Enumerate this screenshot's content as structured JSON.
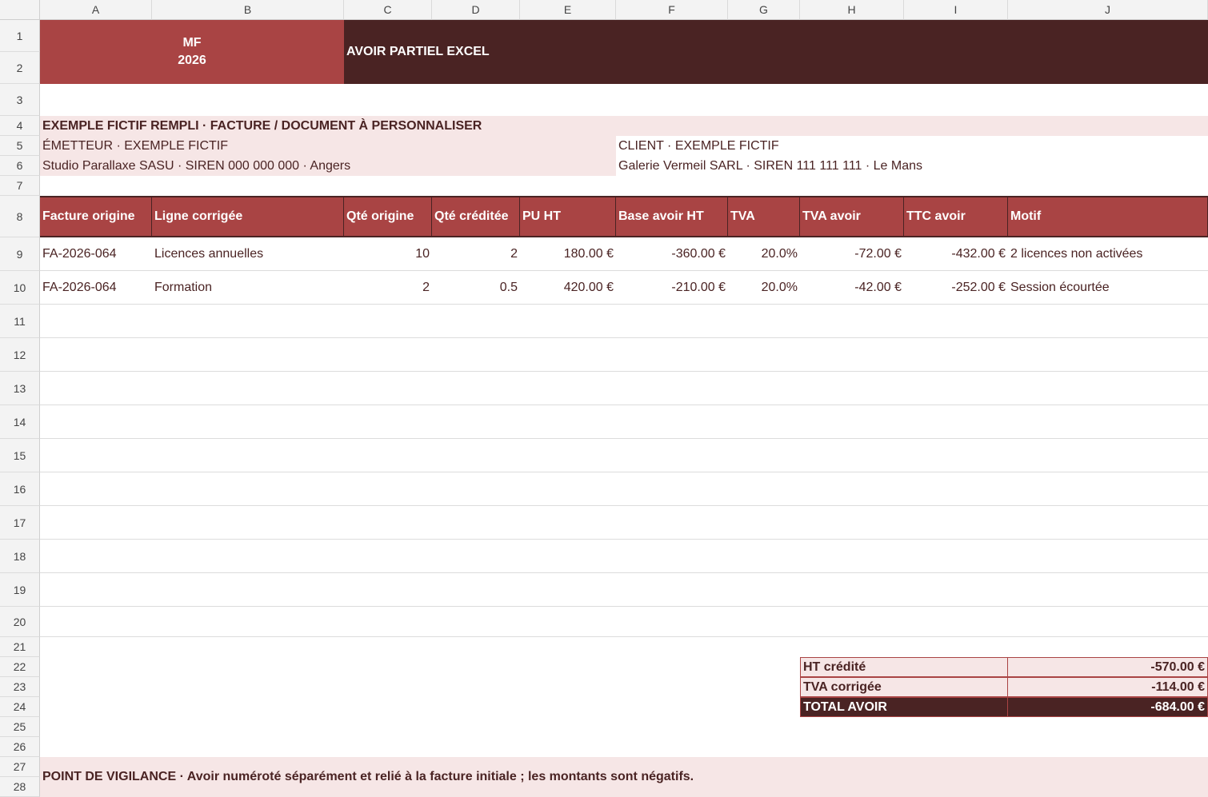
{
  "columns": [
    "A",
    "B",
    "C",
    "D",
    "E",
    "F",
    "G",
    "H",
    "I",
    "J"
  ],
  "rows": [
    "1",
    "2",
    "3",
    "4",
    "5",
    "6",
    "7",
    "8",
    "9",
    "10",
    "11",
    "12",
    "13",
    "14",
    "15",
    "16",
    "17",
    "18",
    "19",
    "20",
    "21",
    "22",
    "23",
    "24",
    "25",
    "26",
    "27",
    "28"
  ],
  "brand": {
    "line1": "MF",
    "line2": "2026"
  },
  "title": "AVOIR PARTIEL EXCEL",
  "subtitle": "EXEMPLE FICTIF REMPLI · FACTURE / DOCUMENT À PERSONNALISER",
  "emitter": {
    "label": "ÉMETTEUR · EXEMPLE FICTIF",
    "value": "Studio Parallaxe SASU · SIREN 000 000 000 · Angers"
  },
  "client": {
    "label": "CLIENT · EXEMPLE FICTIF",
    "value": "Galerie Vermeil SARL · SIREN 111 111 111 · Le Mans"
  },
  "table": {
    "headers": [
      "Facture origine",
      "Ligne corrigée",
      "Qté origine",
      "Qté créditée",
      "PU HT",
      "Base avoir HT",
      "TVA",
      "TVA avoir",
      "TTC avoir",
      "Motif"
    ],
    "rows": [
      [
        "FA-2026-064",
        "Licences annuelles",
        "10",
        "2",
        "180.00 €",
        "-360.00 €",
        "20.0%",
        "-72.00 €",
        "-432.00 €",
        "2 licences non activées"
      ],
      [
        "FA-2026-064",
        "Formation",
        "2",
        "0.5",
        "420.00 €",
        "-210.00 €",
        "20.0%",
        "-42.00 €",
        "-252.00 €",
        "Session écourtée"
      ]
    ]
  },
  "totals": [
    {
      "label": "HT crédité",
      "value": "-570.00 €"
    },
    {
      "label": "TVA corrigée",
      "value": "-114.00 €"
    },
    {
      "label": "TOTAL AVOIR",
      "value": "-684.00 €"
    }
  ],
  "note": "POINT DE VIGILANCE · Avoir numéroté séparément et relié à la facture initiale ; les montants sont négatifs.",
  "colors": {
    "accent": "#a94444",
    "dark": "#4a2323",
    "pink": "#f6e6e6"
  }
}
